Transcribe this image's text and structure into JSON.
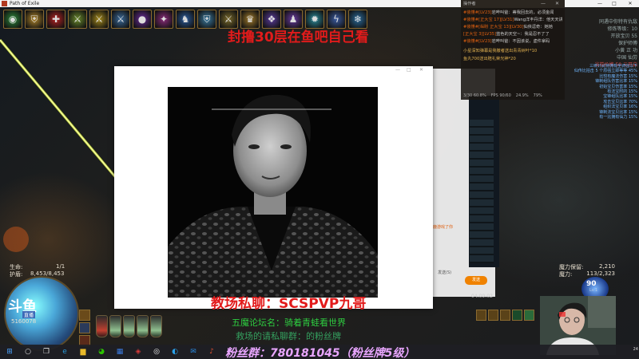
{
  "game_window": {
    "title": "Path of Exile",
    "controls": [
      "—",
      "□",
      "✕"
    ],
    "top_overlay": "封撸30层在鱼吧自己看"
  },
  "skills": [
    {
      "icon": "green-eye-icon",
      "color": "#2d8a3a",
      "glyph": "◉"
    },
    {
      "icon": "shield-icon",
      "color": "#b0862a",
      "glyph": "⛨"
    },
    {
      "icon": "red-cross-icon",
      "color": "#b52222",
      "glyph": "✚"
    },
    {
      "icon": "warrior-icon",
      "color": "#6a8a2a",
      "glyph": "⚔"
    },
    {
      "icon": "warrior-gold-icon",
      "color": "#a58a1a",
      "glyph": "⚔"
    },
    {
      "icon": "warrior-blue-icon",
      "color": "#3a6a9a",
      "glyph": "⚔"
    },
    {
      "icon": "purple-orb-icon",
      "color": "#6a2a9a",
      "glyph": "●"
    },
    {
      "icon": "arcane-icon",
      "color": "#8a2a7a",
      "glyph": "✦"
    },
    {
      "icon": "figure-icon",
      "color": "#2a5a9a",
      "glyph": "♞"
    },
    {
      "icon": "shield-blue-icon",
      "color": "#3a7aa0",
      "glyph": "⛨"
    },
    {
      "icon": "dual-icon",
      "color": "#7a6a2a",
      "glyph": "⚔"
    },
    {
      "icon": "crown-icon",
      "color": "#a07a2a",
      "glyph": "♛"
    },
    {
      "icon": "aura-icon",
      "color": "#5a3a9a",
      "glyph": "❖"
    },
    {
      "icon": "purple-man-icon",
      "color": "#6a3aa0",
      "glyph": "♟"
    },
    {
      "icon": "flame-icon",
      "color": "#2a8a9a",
      "glyph": "✹"
    },
    {
      "icon": "lightning-icon",
      "color": "#3a5aa0",
      "glyph": "ϟ"
    },
    {
      "icon": "frost-icon",
      "color": "#2a6a9a",
      "glyph": "❄"
    }
  ],
  "chat": {
    "header": "操作者",
    "messages": [
      {
        "user": "#装懂#[LV23]",
        "text": "岩哔叫爸：蒂我回去的，必须金闻"
      },
      {
        "user": "#装懂#[正大宝 17][LV31]",
        "text": "Wang洋丰丹洋：他天天讲故事啊你"
      },
      {
        "user": "#装懂#[纵盼 正大宝 13][LV30]",
        "text": "仙侠逗奇：她她"
      },
      {
        "user": "[正大宝 3][LV35]",
        "text": "蓝色的天空~：我是忍不了了"
      },
      {
        "user": "#装懂#[LV23]",
        "text": "岩哔叫爸：不因该说，虚件拿码"
      }
    ],
    "gifts": [
      "小星深知弹幕是我撤者送出青青树叶*10",
      "鱼丸700送出赔礼荣光神*20"
    ],
    "stats": [
      "3/30 60.8%",
      "FPS 90/60",
      "24.9%",
      "79%"
    ]
  },
  "rank": {
    "lines": [
      "同遇中你特有仇敌",
      "修炼等级：10",
      "开放宝贝 55",
      "保护师傅",
      "小黄 正 功",
      "中国 仙劳",
      "当前价格 50 元开启"
    ],
    "highlight_index": 6
  },
  "buffs": [
    "三统计武特拥有坐骑强以下",
    "仙传比拍击 5 个原强立即等等 45%",
    "比较有魔法伤害 15%",
    "锋制组队伤害比率 15%",
    "初始宝贝伤害率 15%",
    "有法宝附的 15%",
    "宝锋组队比率 15%",
    "攻击宝贝比率 70%",
    "组织法宝贝率 16%",
    "锋制法宝贝比率 15%",
    "有一比拥有仙力 15%"
  ],
  "side_app": {
    "link": "鹿游戏了你",
    "send_label": "发送(S)",
    "send_button": "发送",
    "timer": "04:09:02"
  },
  "left_hud": {
    "life_label": "生命:",
    "life_value": "1/1",
    "es_label": "护盾:",
    "es_value": "8,453/8,453",
    "logo": "斗鱼",
    "logo_sub": "直播",
    "level": "5160078"
  },
  "right_hud": {
    "mana_label": "魔力保留:",
    "mana_value": "2,210",
    "mana_label2": "魔力:",
    "mana_value2": "113/2,323",
    "orb_value": "90",
    "orb_sub": "Lv.1"
  },
  "overlays": {
    "red_bottom": "教场私聊：SCSPVP九哥",
    "green_1": "五魔论坛名：骑着青蛙看世界",
    "green_2": "救场的请私聊群：的粉丝牌",
    "fans": "粉丝群：780181045（粉丝牌5级）"
  },
  "taskbar": {
    "icons": [
      {
        "name": "windows-start-icon",
        "glyph": "⊞",
        "color": "#4aa3ff"
      },
      {
        "name": "search-icon",
        "glyph": "○",
        "color": "#ddd"
      },
      {
        "name": "task-view-icon",
        "glyph": "❐",
        "color": "#ddd"
      },
      {
        "name": "edge-browser-icon",
        "glyph": "e",
        "color": "#2a9ad8"
      },
      {
        "name": "file-explorer-icon",
        "glyph": "▆",
        "color": "#e8b92a"
      },
      {
        "name": "wechat-icon",
        "glyph": "◕",
        "color": "#2dc100"
      },
      {
        "name": "app-grid-icon",
        "glyph": "▦",
        "color": "#3a7ae0"
      },
      {
        "name": "game-icon",
        "glyph": "◈",
        "color": "#d83a3a"
      },
      {
        "name": "obs-icon",
        "glyph": "◎",
        "color": "#eee"
      },
      {
        "name": "qq-icon",
        "glyph": "◐",
        "color": "#2aa0e8"
      },
      {
        "name": "mail-icon",
        "glyph": "✉",
        "color": "#2a8ae0"
      },
      {
        "name": "music-icon",
        "glyph": "♪",
        "color": "#e05030"
      }
    ],
    "time": "24"
  }
}
